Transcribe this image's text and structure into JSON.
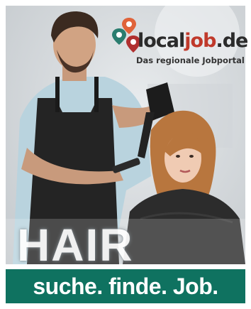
{
  "logo": {
    "word_part1": "local",
    "word_part2": "job",
    "word_part3": ".de",
    "tagline": "Das regionale Jobportal"
  },
  "photo": {
    "overlay_word": "HAIR"
  },
  "banner": {
    "slogan": "suche. finde. Job."
  },
  "colors": {
    "banner_bg": "#0f7260",
    "brand_red": "#c0392b",
    "brand_teal": "#2a7d6f"
  }
}
